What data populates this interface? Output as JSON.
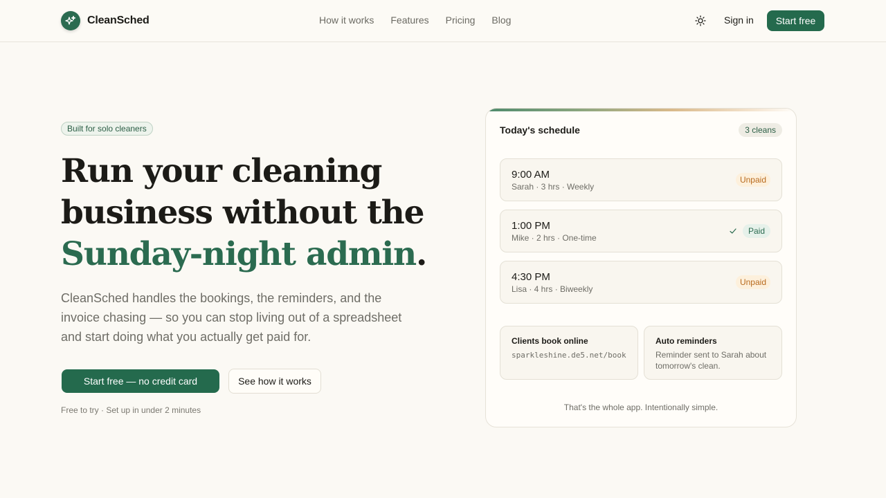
{
  "brand": {
    "name": "CleanSched"
  },
  "nav": {
    "items": [
      "How it works",
      "Features",
      "Pricing",
      "Blog"
    ],
    "sign_in": "Sign in",
    "start_free": "Start free"
  },
  "hero": {
    "badge": "Built for solo cleaners",
    "headline_line1": "Run your cleaning",
    "headline_line2": "business without the",
    "headline_accent": "Sunday-night admin",
    "headline_period": ".",
    "subtext": "CleanSched handles the bookings, the reminders, and the invoice chasing — so you can stop living out of a spreadsheet and start doing what you actually get paid for.",
    "cta_primary": "Start free — no credit card",
    "cta_secondary": "See how it works",
    "fine_print": "Free to try · Set up in under 2 minutes"
  },
  "schedule": {
    "title": "Today's schedule",
    "count": "3 cleans",
    "appointments": [
      {
        "time": "9:00 AM",
        "meta": "Sarah · 3 hrs · Weekly",
        "status": "Unpaid"
      },
      {
        "time": "1:00 PM",
        "meta": "Mike · 2 hrs · One-time",
        "status": "Paid"
      },
      {
        "time": "4:30 PM",
        "meta": "Lisa · 4 hrs · Biweekly",
        "status": "Unpaid"
      }
    ],
    "features": [
      {
        "title": "Clients book online",
        "body": "sparkleshine.de5.net/book"
      },
      {
        "title": "Auto reminders",
        "body": "Reminder sent to Sarah about tomorrow's clean."
      }
    ],
    "footer": "That's the whole app. Intentionally simple."
  },
  "colors": {
    "brand_green": "#246a4d",
    "background": "#fbf9f4",
    "unpaid": "#b86a1d",
    "paid": "#2b6b50"
  }
}
